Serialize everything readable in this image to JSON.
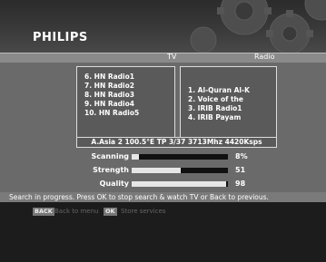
{
  "brand": "PHILIPS",
  "tabs": {
    "tv": "TV",
    "radio": "Radio"
  },
  "tv_list": [
    "6. HN Radio1",
    "7. HN Radio2",
    "8. HN Radio3",
    "9. HN Radio4",
    "10. HN Radio5"
  ],
  "radio_list": [
    "1.  Al-Quran Al-K",
    "2.  Voice of the",
    "3.  IRIB Radio1",
    "4.  IRIB Payam"
  ],
  "transponder_info": "A.Asia 2 100.5°E TP  3/37   3713Mhz  4420Ksps",
  "meters": {
    "scanning": {
      "label": "Scanning",
      "value": "8%",
      "fraction": 0.08
    },
    "strength": {
      "label": "Strength",
      "value": "51",
      "fraction": 0.51
    },
    "quality": {
      "label": "Quality",
      "value": "98",
      "fraction": 0.98
    }
  },
  "status_text": "Search in progress. Press OK to stop search & watch TV or Back to previous.",
  "footer": {
    "back_key": "BACK",
    "back_text": "Back to menu",
    "ok_key": "OK",
    "ok_text": "Store services"
  },
  "colors": {
    "header": "#3a3a3a",
    "panel": "#6a6a6a",
    "meter_fill": "#e6e6e6"
  }
}
